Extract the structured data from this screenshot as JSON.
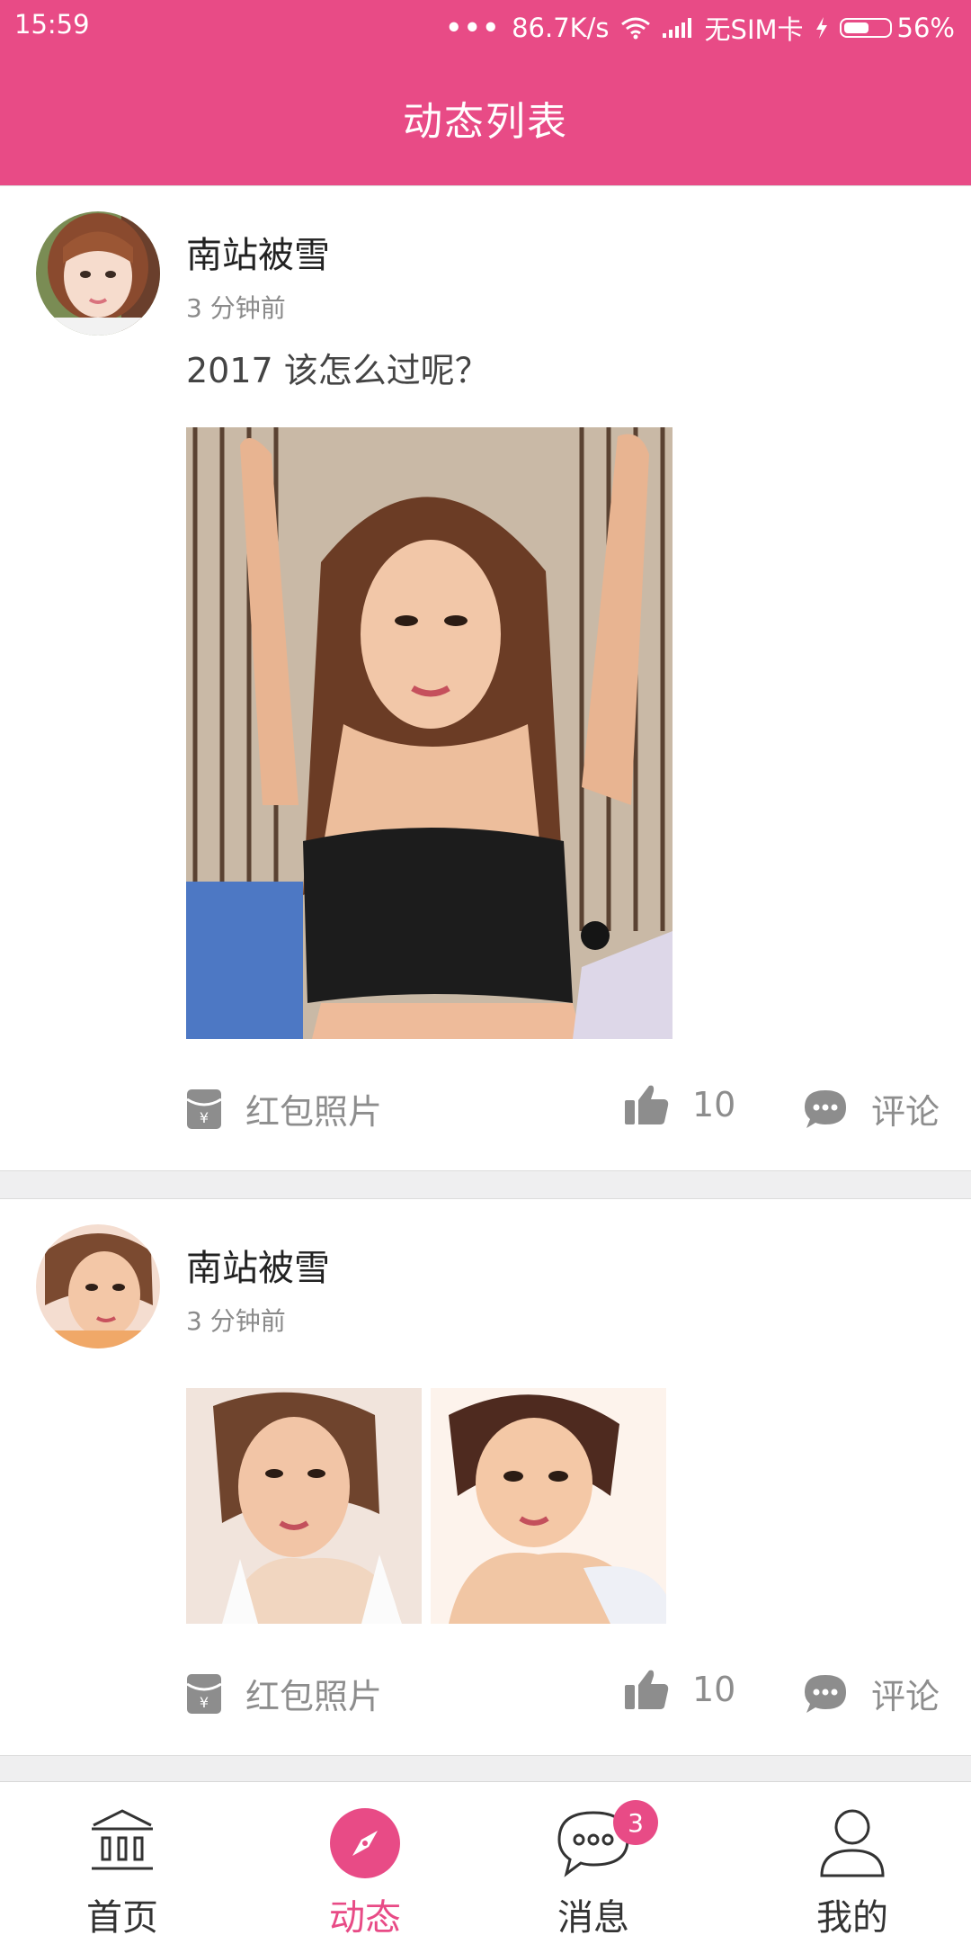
{
  "status_bar": {
    "time": "15:59",
    "dots": "•••",
    "speed": "86.7K/s",
    "carrier": "无SIM卡",
    "battery_level": 0.56,
    "battery_text": "56%"
  },
  "header": {
    "title": "动态列表"
  },
  "posts": [
    {
      "username": "南站被雪",
      "time": "3 分钟前",
      "text": "2017 该怎么过呢？",
      "red_packet_label": "红包照片",
      "like_count": "10",
      "comment_label": "评论"
    },
    {
      "username": "南站被雪",
      "time": "3 分钟前",
      "text": "",
      "red_packet_label": "红包照片",
      "like_count": "10",
      "comment_label": "评论"
    }
  ],
  "tabbar": {
    "tabs": [
      {
        "label": "首页",
        "icon": "home-building-icon",
        "active": false
      },
      {
        "label": "动态",
        "icon": "compass-icon",
        "active": true
      },
      {
        "label": "消息",
        "icon": "chat-bubble-icon",
        "active": false,
        "badge": "3"
      },
      {
        "label": "我的",
        "icon": "user-icon",
        "active": false
      }
    ]
  },
  "colors": {
    "accent": "#e84b86",
    "text_gray": "#8d8d8d"
  }
}
